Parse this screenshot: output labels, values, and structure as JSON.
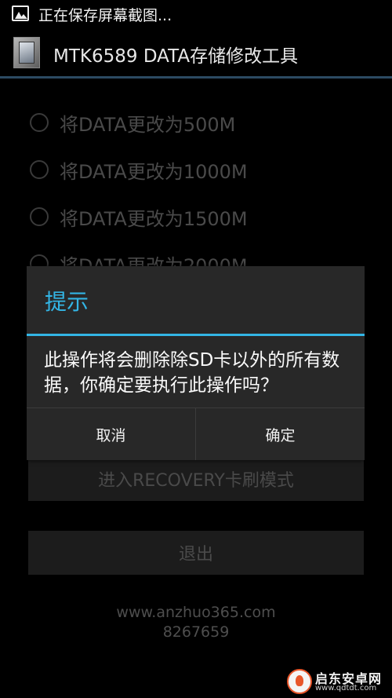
{
  "status_bar": {
    "text": "正在保存屏幕截图..."
  },
  "app": {
    "title": "MTK6589 DATA存储修改工具"
  },
  "options": [
    {
      "label": "将DATA更改为500M"
    },
    {
      "label": "将DATA更改为1000M"
    },
    {
      "label": "将DATA更改为1500M"
    },
    {
      "label": "将DATA更改为2000M"
    }
  ],
  "buttons": {
    "recovery": "进入RECOVERY卡刷模式",
    "exit": "退出"
  },
  "footer": {
    "url": "www.anzhuo365.com",
    "number": "8267659"
  },
  "dialog": {
    "title": "提示",
    "message": "此操作将会删除除SD卡以外的所有数据，你确定要执行此操作吗？",
    "cancel": "取消",
    "confirm": "确定"
  },
  "watermark": {
    "name": "启东安卓网",
    "url": "www.qdtdt.com"
  },
  "colors": {
    "accent": "#33b5e5",
    "dialog_bg": "#282828"
  }
}
